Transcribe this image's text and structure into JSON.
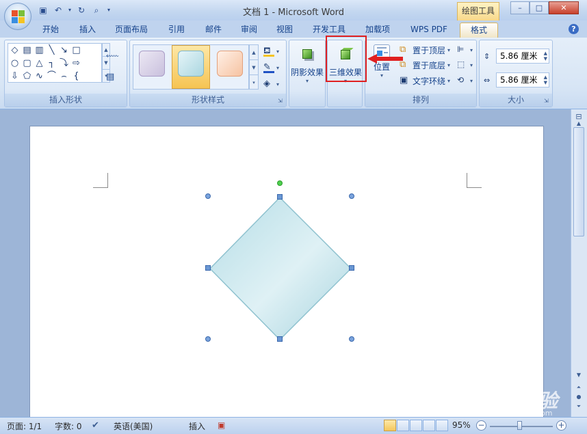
{
  "window": {
    "title": "文档 1 - Microsoft Word",
    "contextual_tab": "绘图工具",
    "minimize": "–",
    "maximize": "□",
    "close": "✕"
  },
  "tabs": [
    {
      "label": "开始"
    },
    {
      "label": "插入"
    },
    {
      "label": "页面布局"
    },
    {
      "label": "引用"
    },
    {
      "label": "邮件"
    },
    {
      "label": "审阅"
    },
    {
      "label": "视图"
    },
    {
      "label": "开发工具"
    },
    {
      "label": "加载项"
    },
    {
      "label": "WPS PDF"
    },
    {
      "label": "格式",
      "active": true
    }
  ],
  "help": "?",
  "ribbon": {
    "insert_shapes": {
      "label": "插入形状"
    },
    "shape_styles": {
      "label": "形状样式"
    },
    "shadow_effects": {
      "label": "阴影效果"
    },
    "threed_effects": {
      "label": "三维效果"
    },
    "arrange": {
      "label": "排列",
      "position": "位置",
      "bring_front": "置于顶层",
      "send_back": "置于底层",
      "text_wrap": "文字环绕"
    },
    "size": {
      "label": "大小",
      "height": "5.86 厘米",
      "width": "5.86 厘米"
    }
  },
  "status": {
    "page": "页面: 1/1",
    "words": "字数: 0",
    "language": "英语(美国)",
    "mode": "插入",
    "zoom": "95%"
  },
  "watermark": {
    "text": "Baidu 经验",
    "sub": "jingyan.baidu.com"
  },
  "colors": {
    "highlight": "#e02020",
    "shape_fill": "#cde8ee",
    "shape_stroke": "#8fc2cf",
    "active_tab": "#f0e6c8"
  }
}
